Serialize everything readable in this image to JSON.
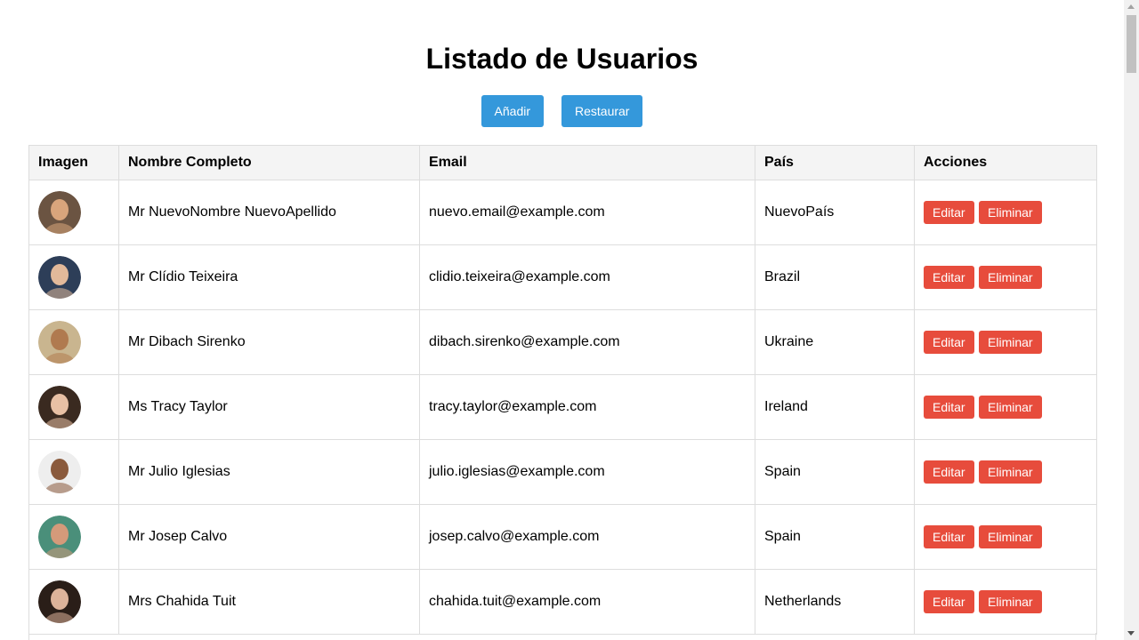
{
  "header": {
    "title": "Listado de Usuarios",
    "add_label": "Añadir",
    "restore_label": "Restaurar"
  },
  "table": {
    "columns": [
      "Imagen",
      "Nombre Completo",
      "Email",
      "País",
      "Acciones"
    ],
    "edit_label": "Editar",
    "delete_label": "Eliminar",
    "rows": [
      {
        "name": "Mr NuevoNombre NuevoApellido",
        "email": "nuevo.email@example.com",
        "country": "NuevoPaís",
        "avatar_bg": "#6b5442",
        "avatar_fg": "#d9a57c"
      },
      {
        "name": "Mr Clídio Teixeira",
        "email": "clidio.teixeira@example.com",
        "country": "Brazil",
        "avatar_bg": "#2d3e58",
        "avatar_fg": "#e2b99a"
      },
      {
        "name": "Mr Dibach Sirenko",
        "email": "dibach.sirenko@example.com",
        "country": "Ukraine",
        "avatar_bg": "#c9b58f",
        "avatar_fg": "#b07a4f"
      },
      {
        "name": "Ms Tracy Taylor",
        "email": "tracy.taylor@example.com",
        "country": "Ireland",
        "avatar_bg": "#3a2a20",
        "avatar_fg": "#e8c0a4"
      },
      {
        "name": "Mr Julio Iglesias",
        "email": "julio.iglesias@example.com",
        "country": "Spain",
        "avatar_bg": "#eeeeee",
        "avatar_fg": "#8a5a3c"
      },
      {
        "name": "Mr Josep Calvo",
        "email": "josep.calvo@example.com",
        "country": "Spain",
        "avatar_bg": "#4a8f7a",
        "avatar_fg": "#d49a7a"
      },
      {
        "name": "Mrs Chahida Tuit",
        "email": "chahida.tuit@example.com",
        "country": "Netherlands",
        "avatar_bg": "#2a1e18",
        "avatar_fg": "#dcb39a"
      }
    ]
  },
  "colors": {
    "primary": "#3498db",
    "danger": "#e74c3c",
    "header_bg": "#f4f4f4",
    "border": "#dddddd"
  }
}
